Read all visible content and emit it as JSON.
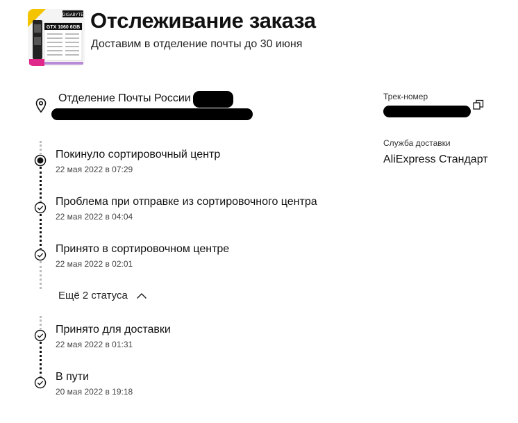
{
  "header": {
    "title": "Отслеживание заказа",
    "subtitle": "Доставим в отделение почты до 30 июня",
    "product_text": "GTX 1060 6GB",
    "product_brand": "GIGABYTE"
  },
  "destination": {
    "label": "Отделение Почты России"
  },
  "shipment": {
    "tracking_label": "Трек-номер",
    "service_label": "Служба доставки",
    "service_value": "AliExpress Стандарт"
  },
  "events_top": [
    {
      "title": "Покинуло сортировочный центр",
      "date": "22 мая 2022 в 07:29",
      "status": "current"
    },
    {
      "title": "Проблема при отправке из сортировочного центра",
      "date": "22 мая 2022 в 04:04",
      "status": "done"
    },
    {
      "title": "Принято в сортировочном центре",
      "date": "22 мая 2022 в 02:01",
      "status": "done"
    }
  ],
  "more_toggle": {
    "label": "Ещё 2 статуса"
  },
  "events_bottom": [
    {
      "title": "Принято для доставки",
      "date": "22 мая 2022 в 01:31",
      "status": "done"
    },
    {
      "title": "В пути",
      "date": "20 мая 2022 в 19:18",
      "status": "done"
    }
  ],
  "colors": {
    "text": "#111111",
    "muted": "#444444",
    "redaction": "#000000"
  }
}
